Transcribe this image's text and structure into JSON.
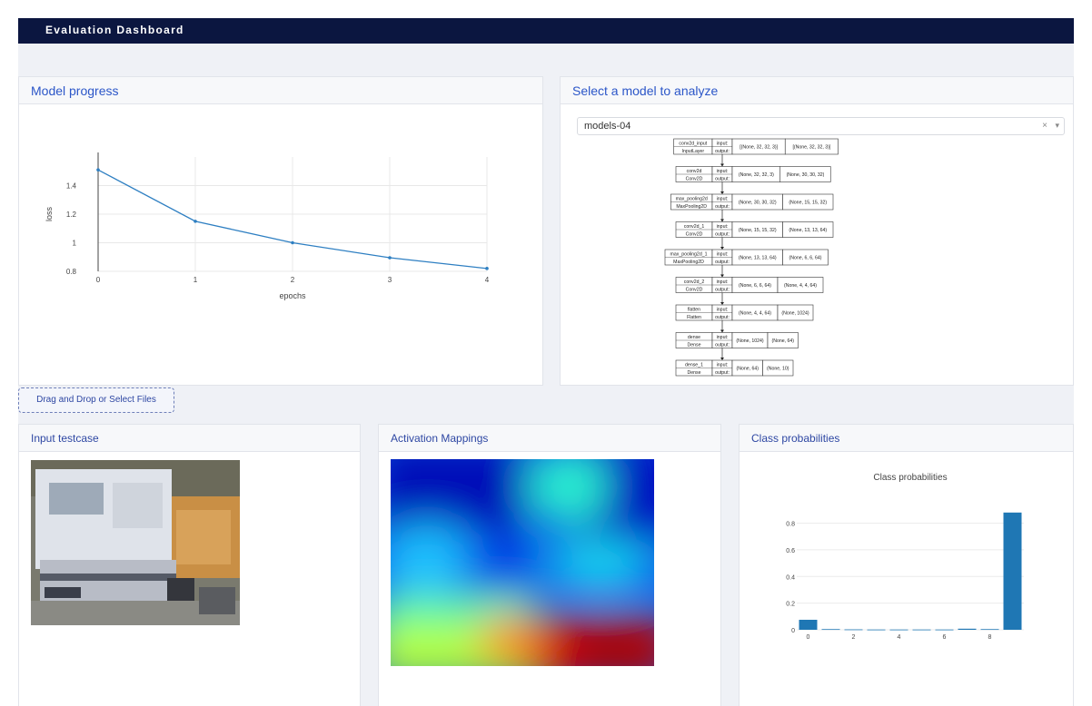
{
  "app": {
    "title": "Evaluation Dashboard"
  },
  "progress": {
    "header": "Model progress",
    "chart_data": {
      "type": "line",
      "x": [
        0,
        1,
        2,
        3,
        4
      ],
      "y": [
        1.51,
        1.15,
        1.0,
        0.895,
        0.82
      ],
      "xlabel": "epochs",
      "ylabel": "loss",
      "xticks": [
        "0",
        "1",
        "2",
        "3",
        "4"
      ],
      "yticks": [
        "0.8",
        "1",
        "1.2",
        "1.4"
      ],
      "ylim": [
        0.8,
        1.6
      ],
      "xlim": [
        0,
        4
      ],
      "grid": true,
      "color": "#2e7fc2"
    }
  },
  "model": {
    "header": "Select a model to analyze",
    "selected": "models-04",
    "clear_icon": "×",
    "arrow_icon": "▾",
    "layers": [
      {
        "name": "conv2d_input",
        "type": "InputLayer",
        "input": "[(None, 32, 32, 3)]",
        "output": "[(None, 32, 32, 3)]"
      },
      {
        "name": "conv2d",
        "type": "Conv2D",
        "input": "(None, 32, 32, 3)",
        "output": "(None, 30, 30, 32)"
      },
      {
        "name": "max_pooling2d",
        "type": "MaxPooling2D",
        "input": "(None, 30, 30, 32)",
        "output": "(None, 15, 15, 32)"
      },
      {
        "name": "conv2d_1",
        "type": "Conv2D",
        "input": "(None, 15, 15, 32)",
        "output": "(None, 13, 13, 64)"
      },
      {
        "name": "max_pooling2d_1",
        "type": "MaxPooling2D",
        "input": "(None, 13, 13, 64)",
        "output": "(None, 6, 6, 64)"
      },
      {
        "name": "conv2d_2",
        "type": "Conv2D",
        "input": "(None, 6, 6, 64)",
        "output": "(None, 4, 4, 64)"
      },
      {
        "name": "flatten",
        "type": "Flatten",
        "input": "(None, 4, 4, 64)",
        "output": "(None, 1024)"
      },
      {
        "name": "dense",
        "type": "Dense",
        "input": "(None, 1024)",
        "output": "(None, 64)"
      },
      {
        "name": "dense_1",
        "type": "Dense",
        "input": "(None, 64)",
        "output": "(None, 10)"
      }
    ],
    "port_labels": {
      "input": "input:",
      "output": "output:"
    }
  },
  "upload": {
    "label": "Drag and Drop or Select Files"
  },
  "testcase": {
    "header": "Input testcase"
  },
  "activation": {
    "header": "Activation Mappings"
  },
  "probabilities": {
    "header": "Class probabilities",
    "chart_data": {
      "type": "bar",
      "title": "Class probabilities",
      "categories": [
        0,
        1,
        2,
        3,
        4,
        5,
        6,
        7,
        8,
        9
      ],
      "values": [
        0.075,
        0.005,
        0.003,
        0.002,
        0.002,
        0.002,
        0.002,
        0.008,
        0.005,
        0.88
      ],
      "xticks": [
        "0",
        "2",
        "4",
        "6",
        "8"
      ],
      "yticks": [
        "0",
        "0.2",
        "0.4",
        "0.6",
        "0.8"
      ],
      "ylim": [
        0,
        0.94
      ],
      "xlim": [
        -0.5,
        9.5
      ],
      "grid": true,
      "color": "#1f77b4"
    }
  }
}
